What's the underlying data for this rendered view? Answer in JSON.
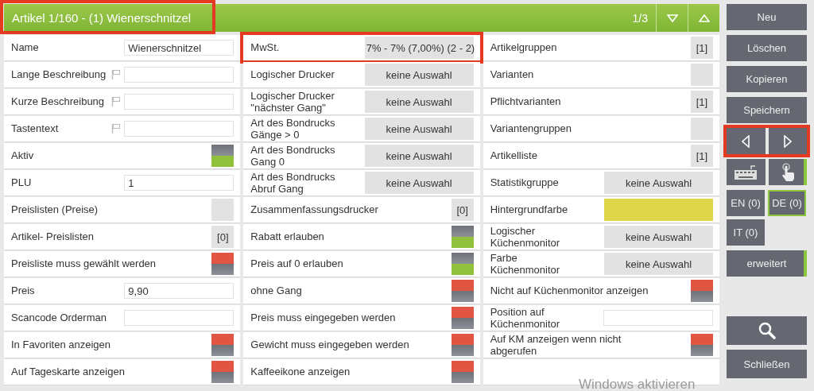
{
  "header": {
    "title": "Artikel 1/160 - (1) Wienerschnitzel",
    "highlighted": true,
    "page": "1/3"
  },
  "columns": [
    {
      "rows": [
        {
          "kind": "text",
          "label": "Name",
          "value": "Wienerschnitzel",
          "flag": false
        },
        {
          "kind": "text",
          "label": "Lange Beschreibung",
          "flag": true
        },
        {
          "kind": "text",
          "label": "Kurze Beschreibung",
          "flag": true
        },
        {
          "kind": "text",
          "label": "Tastentext",
          "flag": true
        },
        {
          "kind": "toggle",
          "label": "Aktiv",
          "on": true
        },
        {
          "kind": "text",
          "label": "PLU",
          "value": "1",
          "flag": false
        },
        {
          "kind": "count",
          "label": "Preislisten (Preise)"
        },
        {
          "kind": "count",
          "label": "Artikel- Preislisten",
          "count": "[0]"
        },
        {
          "kind": "toggle",
          "label": "Preisliste muss gewählt werden",
          "on": false
        },
        {
          "kind": "text",
          "label": "Preis",
          "value": "9,90",
          "flag": false
        },
        {
          "kind": "text",
          "label": "Scancode Orderman",
          "flag": false
        },
        {
          "kind": "toggle",
          "label": "In Favoriten anzeigen",
          "on": false
        },
        {
          "kind": "toggle",
          "label": "Auf Tageskarte anzeigen",
          "on": false
        }
      ]
    },
    {
      "rows": [
        {
          "kind": "select",
          "label": "MwSt.",
          "value": "7% - 7% (7,00%) (2 - 2)",
          "highlighted": true
        },
        {
          "kind": "select",
          "label": "Logischer Drucker",
          "value": "keine Auswahl",
          "highlighted": false
        },
        {
          "kind": "select",
          "label": "Logischer Drucker\n\"nächster Gang\"",
          "value": "keine Auswahl",
          "highlighted": false
        },
        {
          "kind": "select",
          "label": "Art des Bondrucks\nGänge > 0",
          "value": "keine Auswahl",
          "highlighted": false
        },
        {
          "kind": "select",
          "label": "Art des Bondrucks\nGang 0",
          "value": "keine Auswahl",
          "highlighted": false
        },
        {
          "kind": "select",
          "label": "Art des Bondrucks\nAbruf Gang",
          "value": "keine Auswahl",
          "highlighted": false
        },
        {
          "kind": "count",
          "label": "Zusammenfassungsdrucker",
          "count": "[0]"
        },
        {
          "kind": "toggle",
          "label": "Rabatt erlauben",
          "on": true
        },
        {
          "kind": "toggle",
          "label": "Preis auf 0 erlauben",
          "on": true
        },
        {
          "kind": "toggle",
          "label": "ohne Gang",
          "on": false
        },
        {
          "kind": "toggle",
          "label": "Preis muss eingegeben werden",
          "on": false
        },
        {
          "kind": "toggle",
          "label": "Gewicht muss eingegeben werden",
          "on": false
        },
        {
          "kind": "toggle",
          "label": "Kaffeeikone anzeigen",
          "on": false
        }
      ]
    },
    {
      "rows": [
        {
          "kind": "count",
          "label": "Artikelgruppen",
          "count": "[1]"
        },
        {
          "kind": "count",
          "label": "Varianten"
        },
        {
          "kind": "count",
          "label": "Pflichtvarianten",
          "count": "[1]"
        },
        {
          "kind": "count",
          "label": "Variantengruppen"
        },
        {
          "kind": "count",
          "label": "Artikelliste",
          "count": "[1]"
        },
        {
          "kind": "select",
          "label": "Statistikgruppe",
          "value": "keine Auswahl",
          "highlighted": false
        },
        {
          "kind": "color",
          "label": "Hintergrundfarbe",
          "color": "#e0d64a"
        },
        {
          "kind": "select",
          "label": "Logischer\nKüchenmonitor",
          "value": "keine Auswahl",
          "highlighted": false
        },
        {
          "kind": "select",
          "label": "Farbe\nKüchenmonitor",
          "value": "keine Auswahl",
          "highlighted": false
        },
        {
          "kind": "toggle",
          "label": "Nicht auf Küchenmonitor anzeigen",
          "on": false
        },
        {
          "kind": "text",
          "label": "Position auf\nKüchenmonitor",
          "flag": false
        },
        {
          "kind": "toggle",
          "label": "Auf KM anzeigen wenn nicht\nabgerufen",
          "on": false
        },
        {
          "kind": "empty"
        }
      ]
    }
  ],
  "sidebar": {
    "actions": [
      "Neu",
      "Löschen",
      "Kopieren",
      "Speichern"
    ],
    "nav": {
      "highlighted": true
    },
    "tools": [
      {
        "kind": "keyboard",
        "on": false
      },
      {
        "kind": "touch",
        "on": true
      }
    ],
    "languages": [
      {
        "label": "EN (0)",
        "selected": false
      },
      {
        "label": "DE (0)",
        "selected": true
      },
      {
        "label": "IT (0)",
        "selected": false
      }
    ],
    "advanced": {
      "label": "erweitert",
      "on": true
    },
    "close": "Schließen"
  },
  "os_notice": "Windows aktivieren"
}
